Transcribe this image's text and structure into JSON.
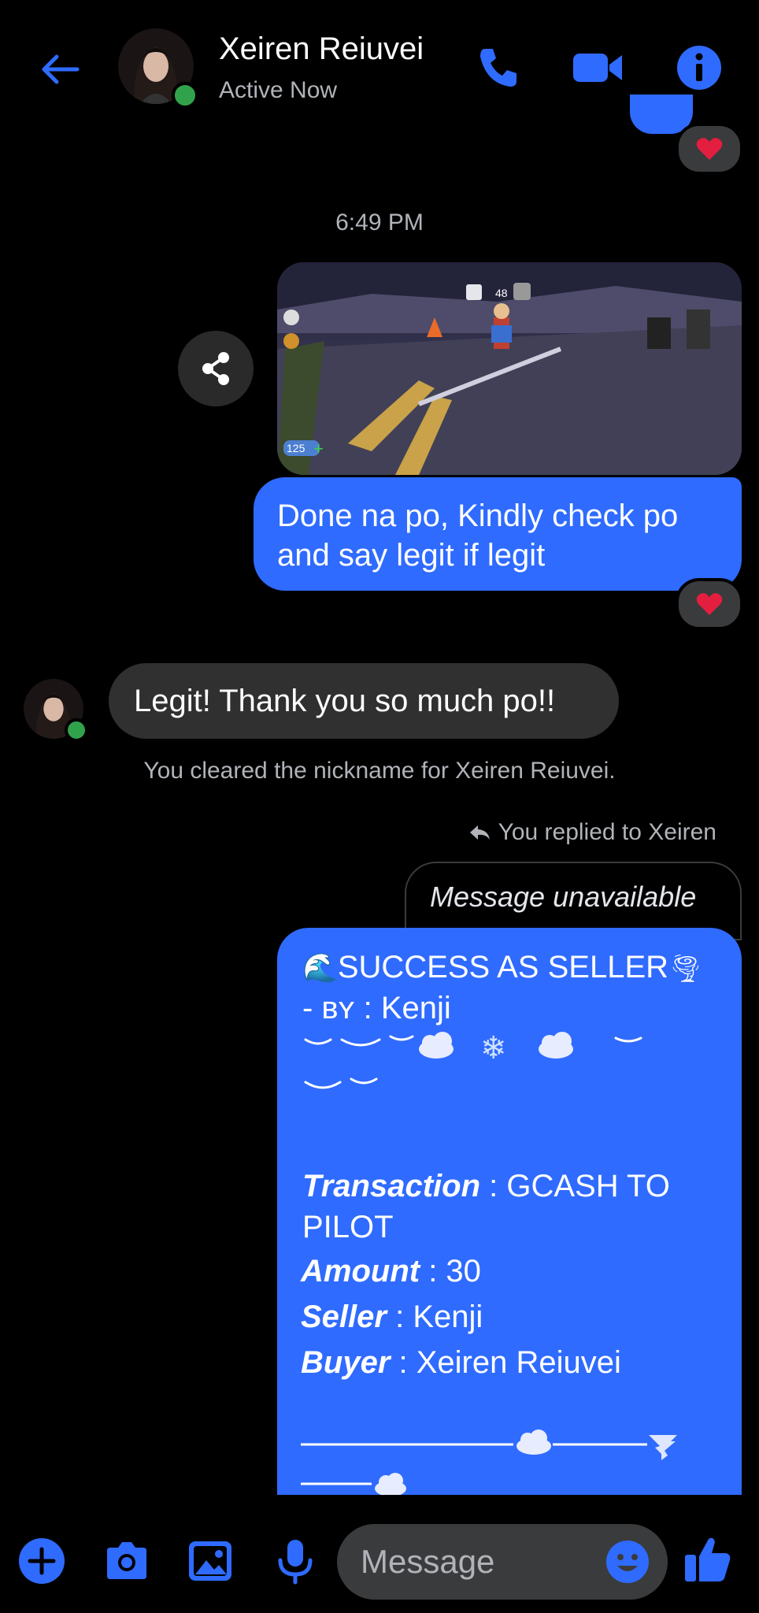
{
  "header": {
    "name": "Xeiren Reiuvei",
    "status": "Active Now"
  },
  "chat": {
    "time": "6:49 PM",
    "my_message": "Done na po, Kindly check po and say legit if legit",
    "their_message": "Legit! Thank you so much po!!",
    "system_notice": "You cleared the nickname for Xeiren Reiuvei.",
    "reply_label": "You replied to Xeiren",
    "unavailable": "Message unavailable",
    "receipt": {
      "title": "SUCCESS AS SELLER",
      "by_prefix": "- ʙʏ :",
      "by_name": "Kenji",
      "line1_label": "Transaction",
      "line1_value": ": GCASH TO",
      "line1_cont": "PILOT",
      "line2_label": "Amount",
      "line2_value": ": 30",
      "line3_label": "Seller",
      "line3_value": ": Kenji",
      "line4_label": "Buyer",
      "line4_value": ": Xeiren Reiuvei"
    },
    "game_hud": {
      "counter": "48",
      "coins": "125"
    }
  },
  "composer": {
    "placeholder": "Message"
  },
  "colors": {
    "accent": "#2f6bff",
    "online": "#31a24c",
    "heart": "#e41e3f"
  },
  "icons": [
    "back-arrow-icon",
    "phone-icon",
    "video-icon",
    "info-icon",
    "share-icon",
    "heart-icon",
    "reply-icon",
    "plus-icon",
    "camera-icon",
    "gallery-icon",
    "mic-icon",
    "emoji-icon",
    "thumbs-up-icon"
  ]
}
